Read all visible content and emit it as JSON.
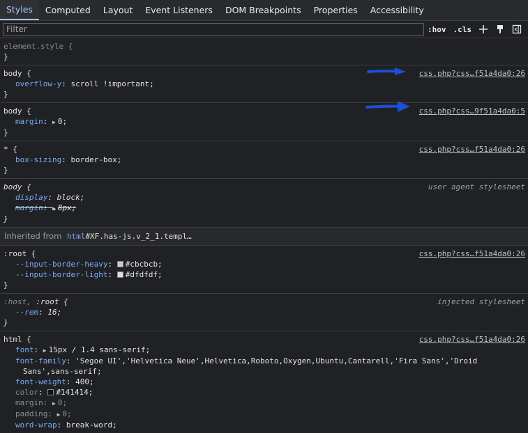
{
  "tabs": [
    "Styles",
    "Computed",
    "Layout",
    "Event Listeners",
    "DOM Breakpoints",
    "Properties",
    "Accessibility"
  ],
  "filter": {
    "placeholder": "Filter",
    "hov": ":hov",
    "cls": ".cls"
  },
  "rules": {
    "element_style": {
      "selector": "element.style {",
      "close": "}"
    },
    "body1": {
      "selector": "body {",
      "source": "css.php?css…f51a4da0:26",
      "pname": "overflow-y",
      "pval": "scroll !important;",
      "close": "}"
    },
    "body2": {
      "selector": "body {",
      "source": "css.php?css…9f51a4da0:5",
      "pname": "margin",
      "pval": "0;",
      "close": "}"
    },
    "star": {
      "selector": "* {",
      "source": "css.php?css…f51a4da0:26",
      "pname": "box-sizing",
      "pval": "border-box;",
      "close": "}"
    },
    "body_ua": {
      "selector": "body {",
      "source": "user agent stylesheet",
      "p1name": "display",
      "p1val": "block;",
      "p2name": "margin",
      "p2val": "8px;",
      "close": "}"
    },
    "inherited": {
      "label": "Inherited from",
      "tag": "html",
      "cls": "#XF.has-js.v_2_1.templ…"
    },
    "root": {
      "selector": ":root {",
      "source": "css.php?css…f51a4da0:26",
      "p1name": "--input-border-heavy",
      "p1val": "#cbcbcb;",
      "p1color": "#cbcbcb",
      "p2name": "--input-border-light",
      "p2val": "#dfdfdf;",
      "p2color": "#dfdfdf",
      "close": "}"
    },
    "host": {
      "sel1": ":host,",
      "sel2": ":root {",
      "source": "injected stylesheet",
      "pname": "--rem",
      "pval": "16;",
      "close": "}"
    },
    "html": {
      "selector": "html {",
      "source": "css.php?css…f51a4da0:26",
      "font_name": "font",
      "font_val": "15px / 1.4 sans-serif;",
      "ff_name": "font-family",
      "ff_val": "'Segoe UI','Helvetica Neue',Helvetica,Roboto,Oxygen,Ubuntu,Cantarell,'Fira Sans','Droid",
      "ff_cont": "Sans',sans-serif;",
      "fw_name": "font-weight",
      "fw_val": "400;",
      "color_name": "color",
      "color_val": "#141414;",
      "color_swatch": "#141414",
      "margin_name": "margin",
      "margin_val": "0;",
      "padding_name": "padding",
      "padding_val": "0;",
      "ww_name": "word-wrap",
      "ww_val": "break-word;"
    }
  },
  "annotation_color": "#1a4fd6"
}
